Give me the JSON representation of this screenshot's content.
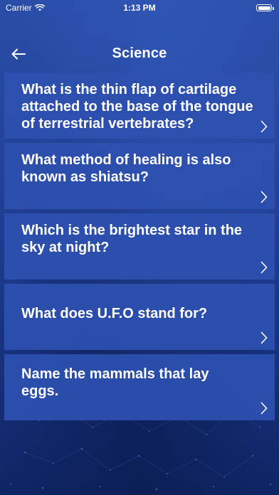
{
  "status_bar": {
    "carrier": "Carrier",
    "time": "1:13 PM"
  },
  "nav": {
    "title": "Science",
    "back_icon": "arrow-left-icon"
  },
  "questions": [
    "What is the thin flap of cartilage attached to the base of the tongue of terrestrial vertebrates?",
    "What method of healing is also known as shiatsu?",
    "Which is the brightest star in the sky at night?",
    "What does U.F.O stand for?",
    "Name the mammals that lay eggs."
  ],
  "colors": {
    "background": "#213f96",
    "card": "#2e50b0",
    "text": "#ffffff"
  }
}
